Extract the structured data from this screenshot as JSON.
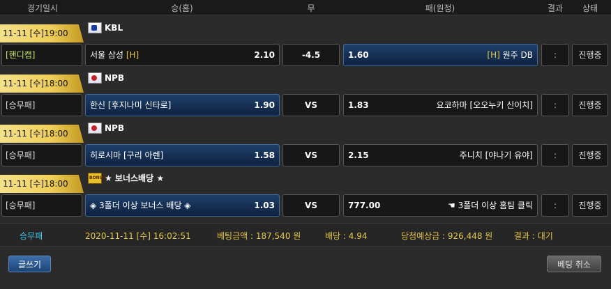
{
  "header": {
    "date": "경기일시",
    "home": "승(홈)",
    "draw": "무",
    "away": "패(원정)",
    "result": "결과",
    "status": "상태"
  },
  "games": [
    {
      "datetime": "11-11 [수]19:00",
      "league_icon": "kbl-flag-icon",
      "league": "KBL",
      "type": "[핸디캡]",
      "home_name": "서울 삼성",
      "home_mark": "[H]",
      "home_odd": "2.10",
      "draw": "-4.5",
      "away_odd": "1.60",
      "away_mark": "[H]",
      "away_name": "원주 DB",
      "result": ":",
      "status": "진행중"
    },
    {
      "datetime": "11-11 [수]18:00",
      "league_icon": "japan-flag-icon",
      "league": "NPB",
      "type": "[승무패]",
      "home_name": "한신 [후지나미 신타로]",
      "home_odd": "1.90",
      "draw": "VS",
      "away_odd": "1.83",
      "away_name": "요코하마 [오오누키 신이치]",
      "result": ":",
      "status": "진행중"
    },
    {
      "datetime": "11-11 [수]18:00",
      "league_icon": "japan-flag-icon",
      "league": "NPB",
      "type": "[승무패]",
      "home_name": "히로시마 [구리 아렌]",
      "home_odd": "1.58",
      "draw": "VS",
      "away_odd": "2.15",
      "away_name": "주니치 [야나기 유야]",
      "result": ":",
      "status": "진행중"
    },
    {
      "datetime": "11-11 [수]18:00",
      "league_icon": "bonus-icon",
      "league": "★ 보너스배당 ★",
      "type": "[승무패]",
      "home_name": "◈ 3폴더 이상 보너스 배당 ◈",
      "home_odd": "1.03",
      "draw": "VS",
      "away_odd": "777.00",
      "away_name": "☚ 3폴더 이상 홈팀 클릭",
      "result": ":",
      "status": "진행중"
    }
  ],
  "summary": {
    "type": "승무패",
    "time": "2020-11-11 [수] 16:02:51",
    "bet_amount": "베팅금액 : 187,540 원",
    "odds": "배당 : 4.94",
    "expected_win": "당첨예상금 : 926,448 원",
    "result": "결과 : 대기"
  },
  "buttons": {
    "write": "글쓰기",
    "cancel": "베팅 취소"
  },
  "colors": {
    "accent_gold": "#e6c94a",
    "accent_cyan": "#3fc8e8",
    "selected_blue": "#1e3f6a"
  }
}
